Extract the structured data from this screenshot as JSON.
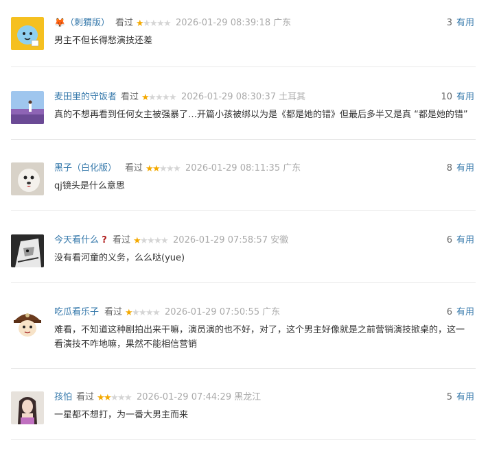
{
  "reviews": [
    {
      "username": "（刺猬版）",
      "status": "看过",
      "rating": 1,
      "time": "2026-01-29 08:39:18",
      "location": "广东",
      "votes": "3",
      "vote_label": "有用",
      "text": "男主不但长得愁演技还差",
      "user_prefix_icon": "fox-emoji-icon"
    },
    {
      "username": "麦田里的守饭者",
      "status": "看过",
      "rating": 1,
      "time": "2026-01-29 08:30:37",
      "location": "土耳其",
      "votes": "10",
      "vote_label": "有用",
      "text": "真的不想再看到任何女主被强暴了…开篇小孩被绑以为是《都是她的错》但最后多半又是真 “都是她的错”"
    },
    {
      "username": "黑子（白化版）",
      "status": "看过",
      "rating": 2,
      "time": "2026-01-29 08:11:35",
      "location": "广东",
      "votes": "8",
      "vote_label": "有用",
      "text": "qj镜头是什么意思"
    },
    {
      "username": "今天看什么",
      "status": "看过",
      "rating": 1,
      "time": "2026-01-29 07:58:57",
      "location": "安徽",
      "votes": "6",
      "vote_label": "有用",
      "text": "没有看河童的义务，么么哒(yue)",
      "user_suffix_icon": "question-mark-emoji-icon"
    },
    {
      "username": "吃瓜看乐子",
      "status": "看过",
      "rating": 1,
      "time": "2026-01-29 07:50:55",
      "location": "广东",
      "votes": "6",
      "vote_label": "有用",
      "text": "难看，不知道这种剧拍出来干嘛，演员演的也不好，对了，这个男主好像就是之前营销演技掀桌的，这一看演技不咋地嘛，果然不能相信营销"
    },
    {
      "username": "孩怕",
      "status": "看过",
      "rating": 2,
      "time": "2026-01-29 07:44:29",
      "location": "黑龙江",
      "votes": "5",
      "vote_label": "有用",
      "text": "一星都不想打，为一番大男主而来"
    }
  ],
  "colors": {
    "link": "#3377aa",
    "star_on": "#f4a900",
    "star_off": "#d5d5d5",
    "muted": "#aaaaaa"
  }
}
